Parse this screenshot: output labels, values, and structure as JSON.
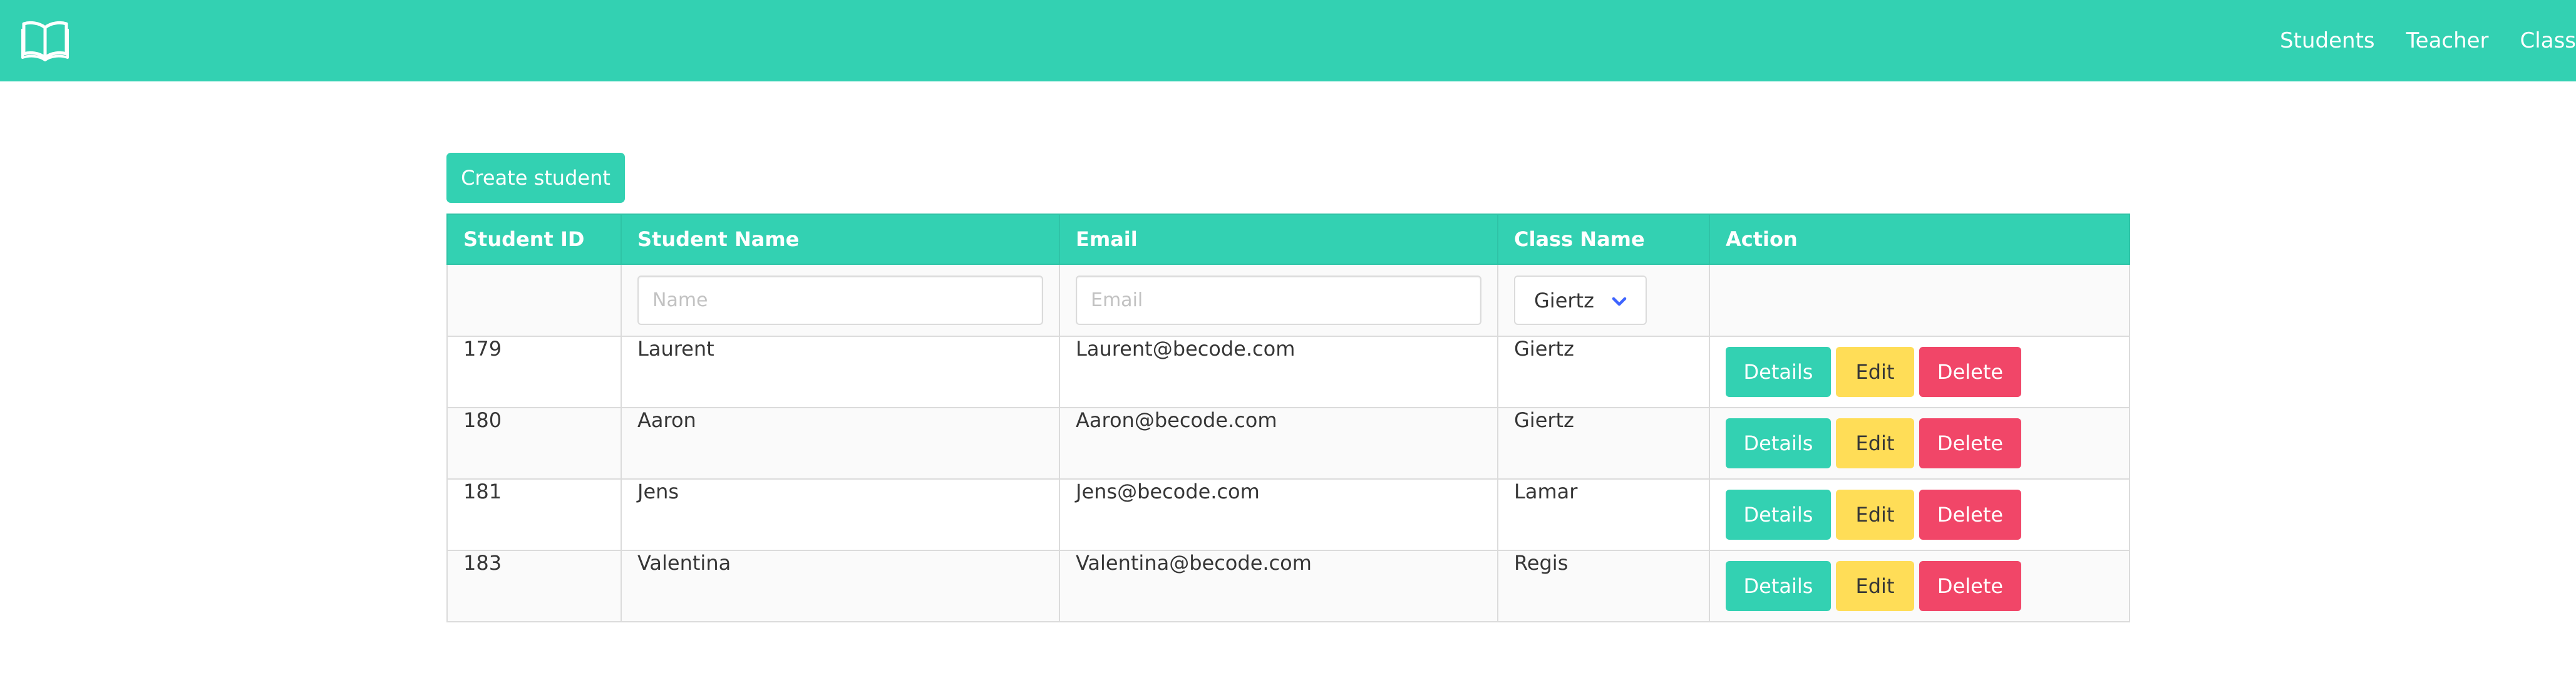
{
  "nav": {
    "links": [
      "Students",
      "Teacher",
      "Class"
    ]
  },
  "toolbar": {
    "create_label": "Create student"
  },
  "table": {
    "headers": [
      "Student ID",
      "Student Name",
      "Email",
      "Class Name",
      "Action"
    ],
    "filters": {
      "name_placeholder": "Name",
      "email_placeholder": "Email",
      "class_selected": "Giertz"
    },
    "rows": [
      {
        "id": "179",
        "name": "Laurent",
        "email": "Laurent@becode.com",
        "class": "Giertz"
      },
      {
        "id": "180",
        "name": "Aaron",
        "email": "Aaron@becode.com",
        "class": "Giertz"
      },
      {
        "id": "181",
        "name": "Jens",
        "email": "Jens@becode.com",
        "class": "Lamar"
      },
      {
        "id": "183",
        "name": "Valentina",
        "email": "Valentina@becode.com",
        "class": "Regis"
      }
    ],
    "actions": {
      "details_label": "Details",
      "edit_label": "Edit",
      "delete_label": "Delete"
    }
  },
  "colors": {
    "primary": "#33d1b2",
    "warning": "#ffdd57",
    "danger": "#f14668",
    "chevron": "#3e64ff"
  },
  "icons": {
    "logo": "open-book-icon",
    "select_arrow": "chevron-down-icon"
  }
}
